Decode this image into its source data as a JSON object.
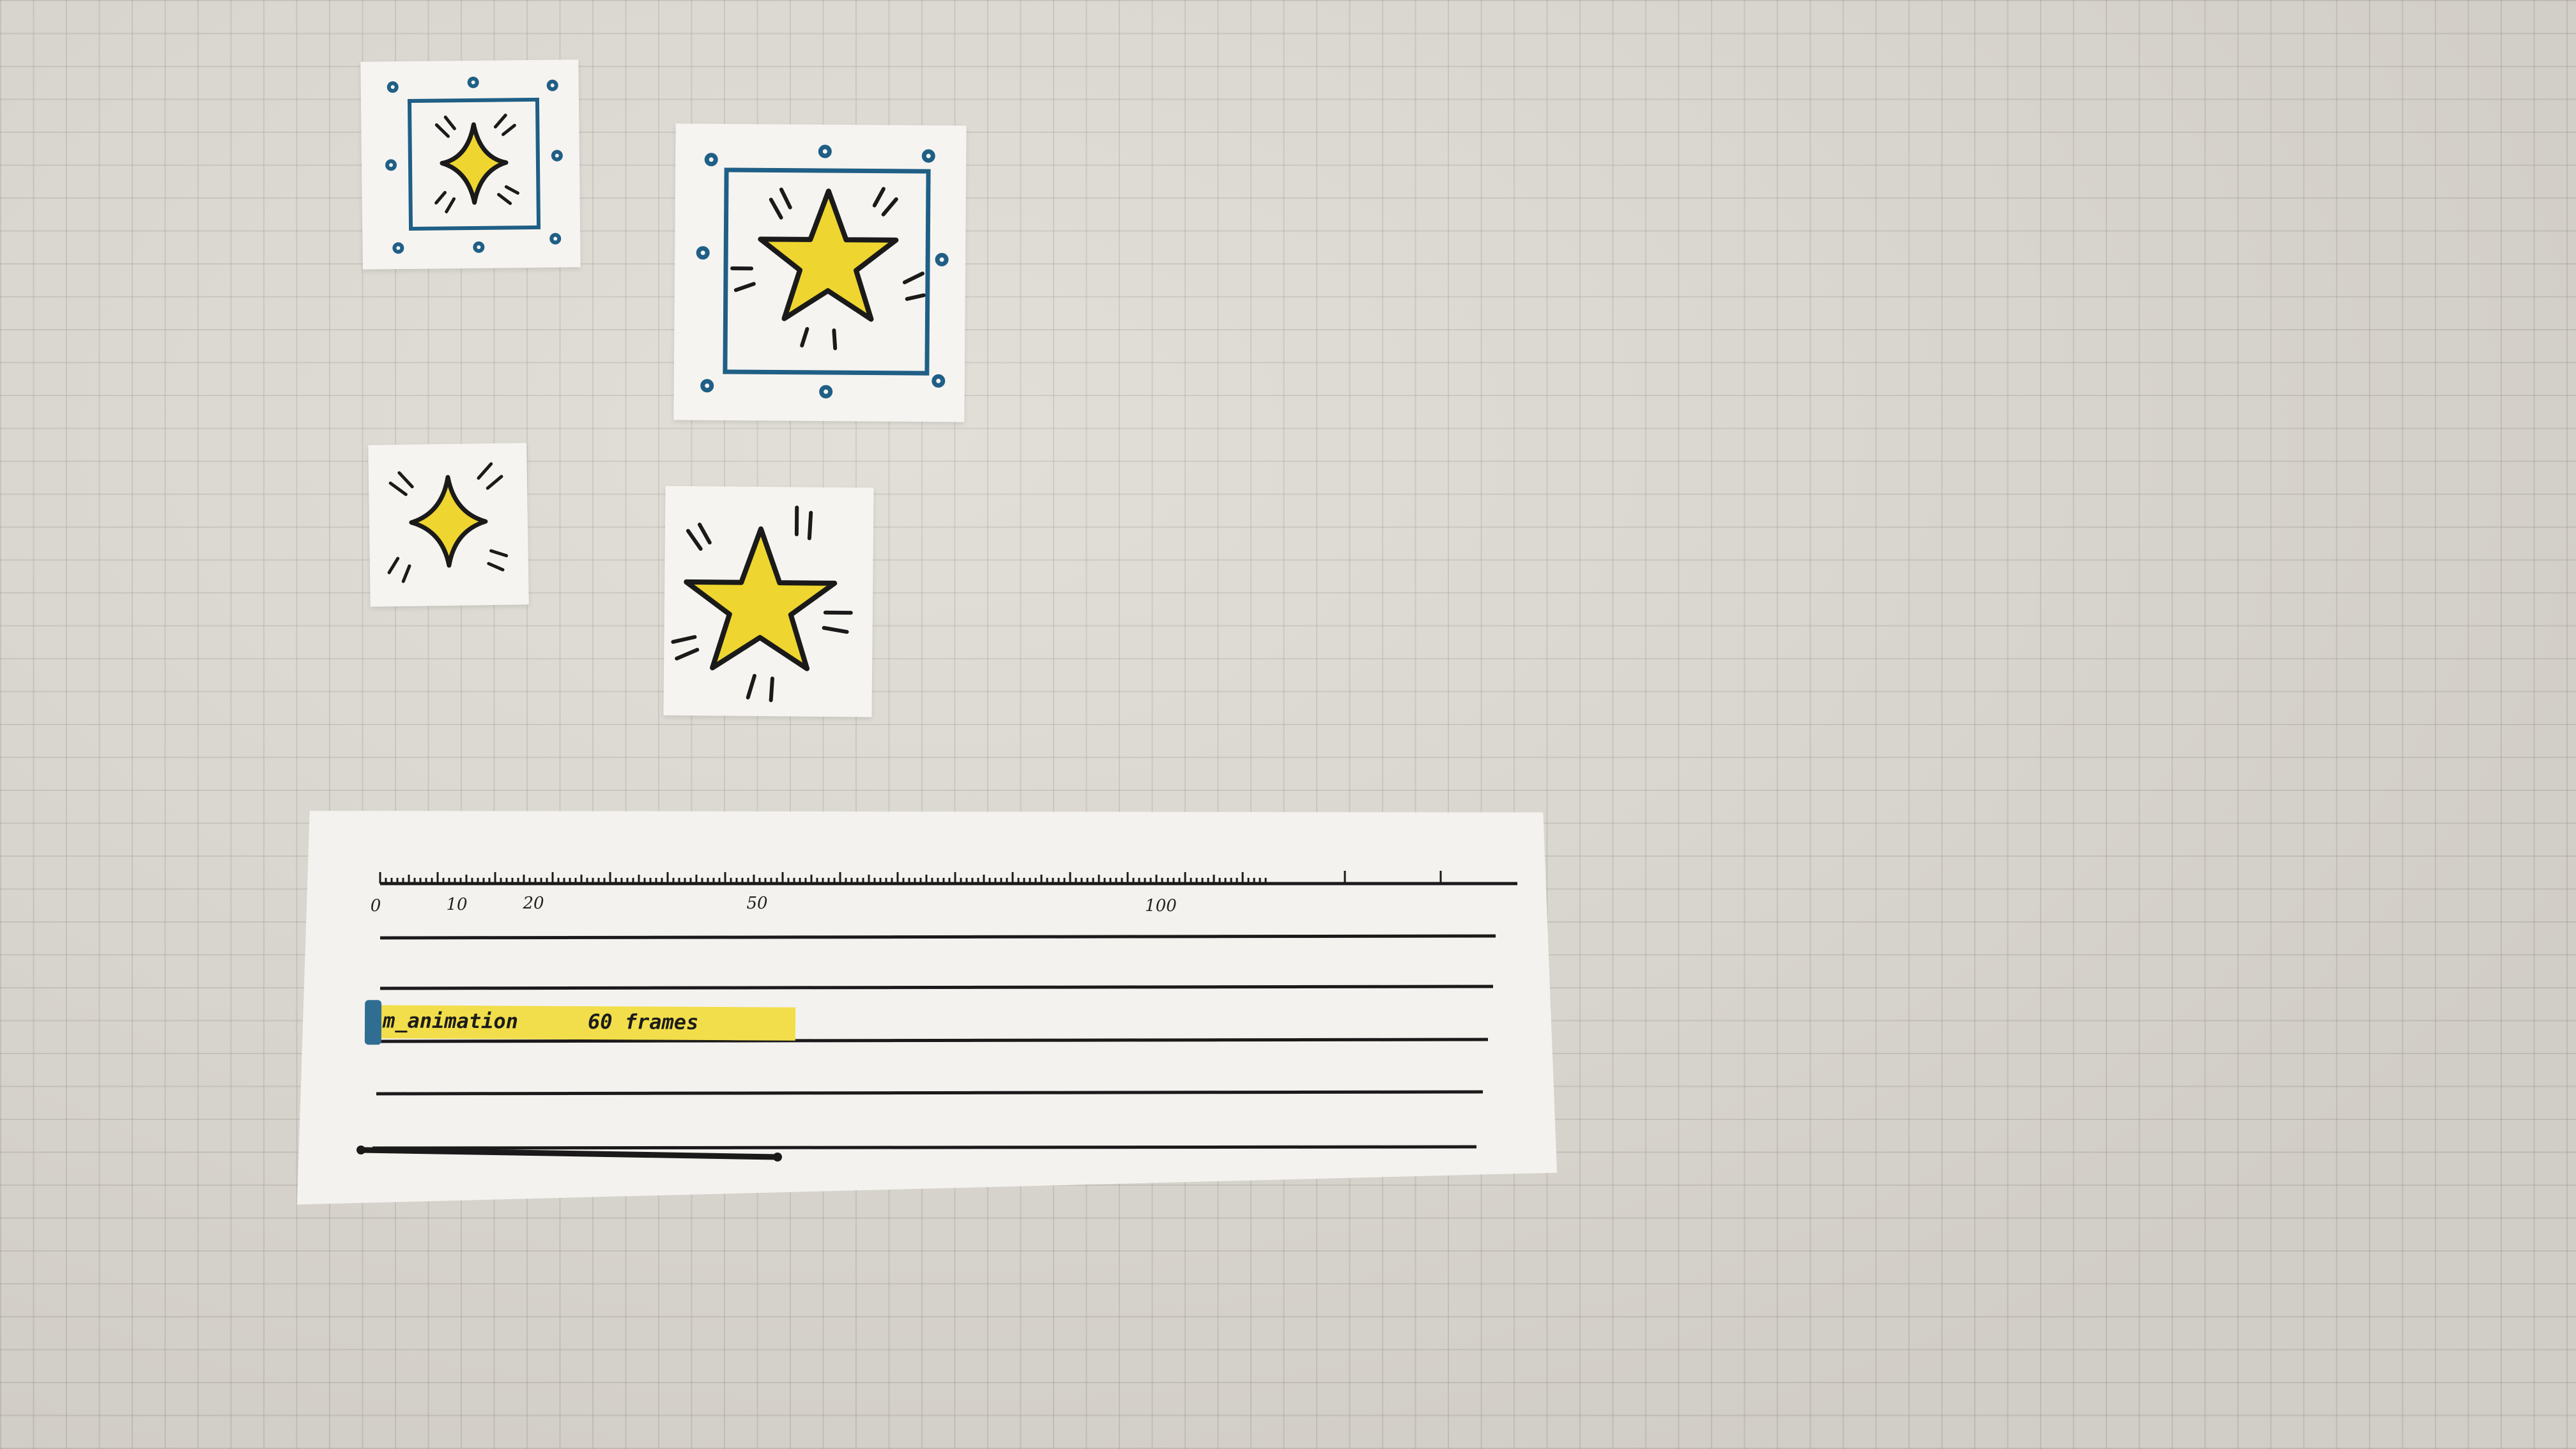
{
  "timeline": {
    "ruler_labels": [
      {
        "value": 0,
        "label": "0"
      },
      {
        "value": 10,
        "label": "10"
      },
      {
        "value": 20,
        "label": "20"
      },
      {
        "value": 50,
        "label": "50"
      },
      {
        "value": 100,
        "label": "100"
      }
    ],
    "clip": {
      "name": "m_animation",
      "frames": "60 frames"
    },
    "track_count": 5
  },
  "colors": {
    "clip_fill": "#f2de4a",
    "clip_handle": "#2f6e92",
    "star_fill": "#efd52f",
    "frame_stroke": "#1f5f86",
    "ink": "#1a1a1a"
  },
  "icons": [
    {
      "name": "sparkle-in-frame-icon",
      "selected": true
    },
    {
      "name": "star-in-frame-icon",
      "selected": true
    },
    {
      "name": "sparkle-icon",
      "selected": false
    },
    {
      "name": "star-icon",
      "selected": false
    }
  ]
}
